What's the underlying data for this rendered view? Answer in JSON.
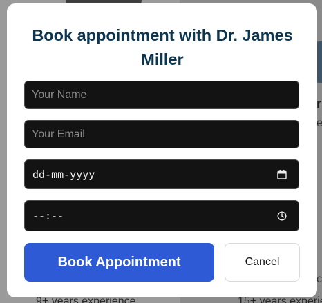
{
  "background": {
    "partial_title": "r",
    "partial_subtitle": "e",
    "partial_right_letter": "c",
    "experience_left": "9+ years experience",
    "experience_right": "15+ years experien"
  },
  "modal": {
    "title": "Book appointment with Dr. James Miller",
    "name_placeholder": "Your Name",
    "email_placeholder": "Your Email",
    "date_placeholder": "dd-mm-yyyy",
    "time_placeholder": "--:--",
    "book_label": "Book Appointment",
    "cancel_label": "Cancel"
  },
  "icons": {
    "date": "calendar-icon",
    "time": "clock-icon"
  },
  "colors": {
    "title": "#0c3550",
    "primary_button": "#2e5ad6",
    "input_background": "#131313"
  }
}
